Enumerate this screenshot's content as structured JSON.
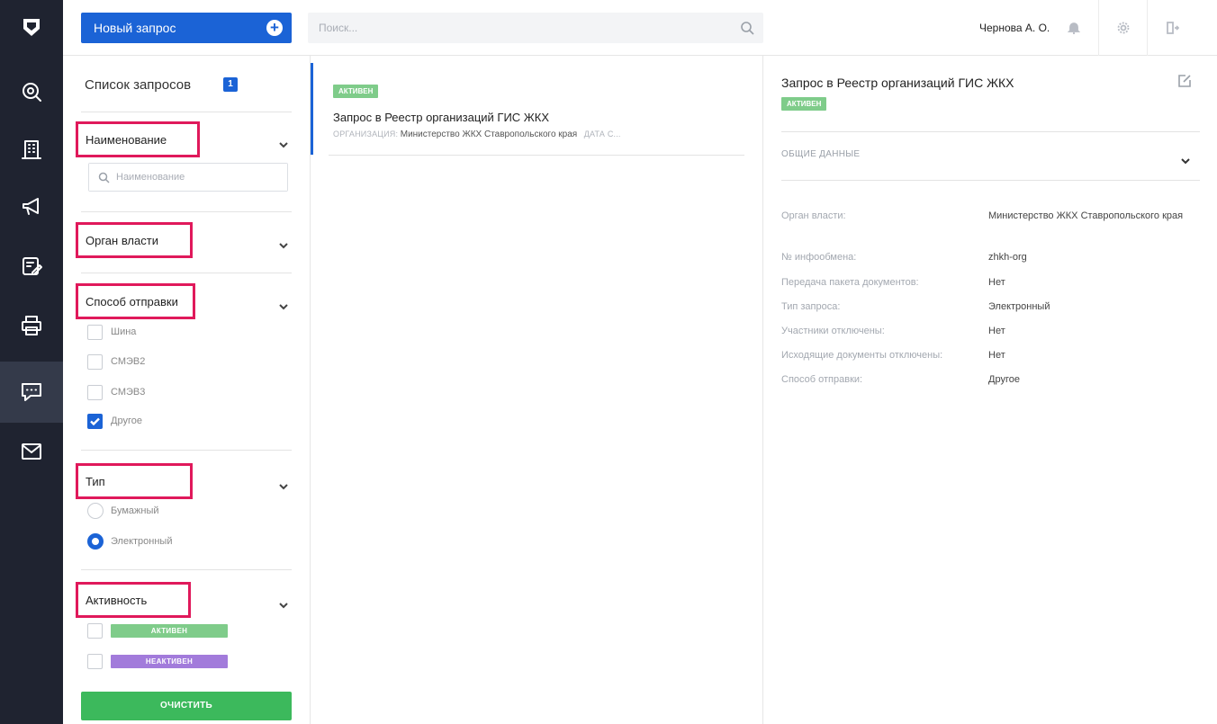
{
  "rail": {
    "items": [
      {
        "name": "search-nav",
        "icon": "magnifier-icon"
      },
      {
        "name": "building-nav",
        "icon": "building-icon"
      },
      {
        "name": "megaphone-nav",
        "icon": "megaphone-icon"
      },
      {
        "name": "edit-doc-nav",
        "icon": "document-edit-icon"
      },
      {
        "name": "printer-nav",
        "icon": "printer-icon"
      },
      {
        "name": "chat-nav",
        "icon": "chat-icon",
        "active": true
      },
      {
        "name": "mail-nav",
        "icon": "mail-icon"
      }
    ]
  },
  "topbar": {
    "new_request": "Новый запрос",
    "search_placeholder": "Поиск...",
    "user": "Чернова А. О."
  },
  "filters": {
    "list_title": "Список запросов",
    "count": "1",
    "name_section": "Наименование",
    "name_placeholder": "Наименование",
    "authority_section": "Орган власти",
    "send_section": "Способ отправки",
    "send_options": [
      {
        "label": "Шина",
        "checked": false
      },
      {
        "label": "СМЭВ2",
        "checked": false
      },
      {
        "label": "СМЭВ3",
        "checked": false
      },
      {
        "label": "Другое",
        "checked": true
      }
    ],
    "type_section": "Тип",
    "type_options": [
      {
        "label": "Бумажный",
        "selected": false
      },
      {
        "label": "Электронный",
        "selected": true
      }
    ],
    "activity_section": "Активность",
    "activity_options": [
      {
        "label": "АКТИВЕН",
        "color": "#7fcc8a"
      },
      {
        "label": "НЕАКТИВЕН",
        "color": "#a27bdb"
      }
    ],
    "clear_button": "ОЧИСТИТЬ"
  },
  "list": {
    "item": {
      "status": "АКТИВЕН",
      "title": "Запрос в Реестр организаций ГИС ЖКХ",
      "org_label": "ОРГАНИЗАЦИЯ:",
      "org_value": "Министерство ЖКХ Ставропольского края",
      "date_label": "ДАТА С..."
    }
  },
  "details": {
    "title": "Запрос в Реестр организаций ГИС ЖКХ",
    "status": "АКТИВЕН",
    "section": "ОБЩИЕ ДАННЫЕ",
    "fields": [
      {
        "label": "Орган власти:",
        "value": "Министерство ЖКХ Ставропольского края"
      },
      {
        "label": "№ инфообмена:",
        "value": "zhkh-org"
      },
      {
        "label": "Передача пакета документов:",
        "value": "Нет"
      },
      {
        "label": "Тип запроса:",
        "value": "Электронный"
      },
      {
        "label": "Участники отключены:",
        "value": "Нет"
      },
      {
        "label": "Исходящие документы отключены:",
        "value": "Нет"
      },
      {
        "label": "Способ отправки:",
        "value": "Другое"
      }
    ]
  },
  "colors": {
    "accent": "#1b63d6",
    "highlight": "#e0195b",
    "active_green": "#7fcc8a",
    "inactive_purple": "#a27bdb",
    "clear_green": "#3cb95c",
    "rail": "#1f2330"
  }
}
